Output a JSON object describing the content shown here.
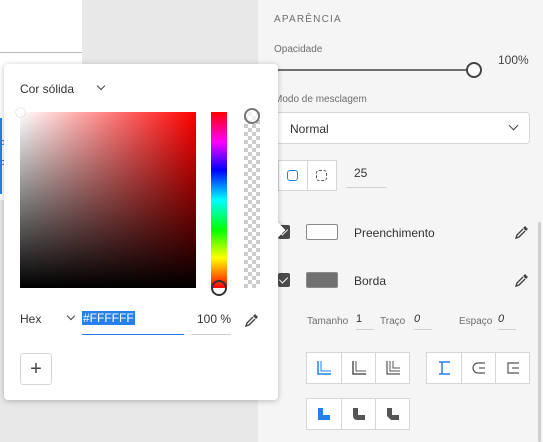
{
  "panel": {
    "section_title": "APARÊNCIA",
    "opacity": {
      "label": "Opacidade",
      "value_text": "100%",
      "value": 100
    },
    "blend_mode": {
      "label": "Modo de mesclagem",
      "value": "Normal"
    },
    "corner_radius": {
      "value": "25"
    },
    "fill": {
      "label": "Preenchimento",
      "enabled": true,
      "color": "#FFFFFF"
    },
    "border": {
      "label": "Borda",
      "enabled": true,
      "color": "#707070"
    },
    "stroke": {
      "size_label": "Tamanho",
      "size_value": "1",
      "dash_label": "Traço",
      "dash_value": "0",
      "gap_label": "Espaço",
      "gap_value": "0"
    }
  },
  "color_picker": {
    "fill_type": "Cor sólida",
    "hex_mode": "Hex",
    "hex_value": "#FFFFFF",
    "alpha_value": "100 %",
    "add_label": "+",
    "hue_color": "#FF0000"
  },
  "colors": {
    "accent": "#2680EB"
  }
}
